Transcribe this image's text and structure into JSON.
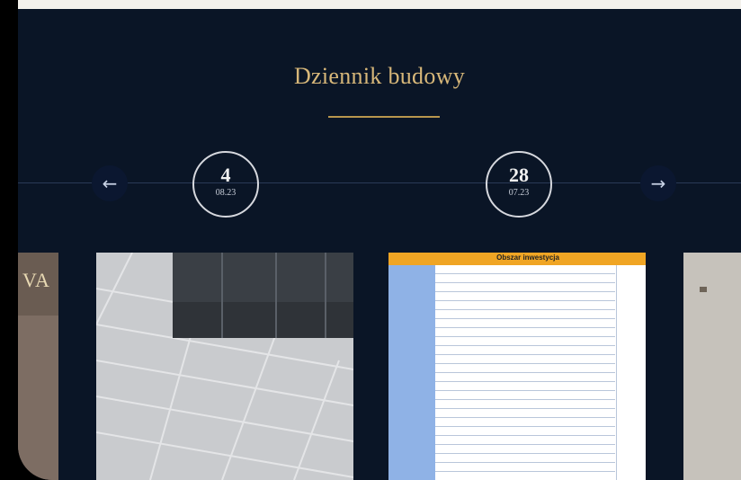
{
  "section": {
    "title": "Dziennik budowy"
  },
  "timeline": {
    "prev_icon": "arrow-left-icon",
    "next_icon": "arrow-right-icon",
    "entries": [
      {
        "day": "4",
        "date": "08.23"
      },
      {
        "day": "28",
        "date": "07.23"
      }
    ]
  },
  "cards": {
    "left_thumb_text": "VA",
    "table_header": "Obszar inwestycja"
  }
}
